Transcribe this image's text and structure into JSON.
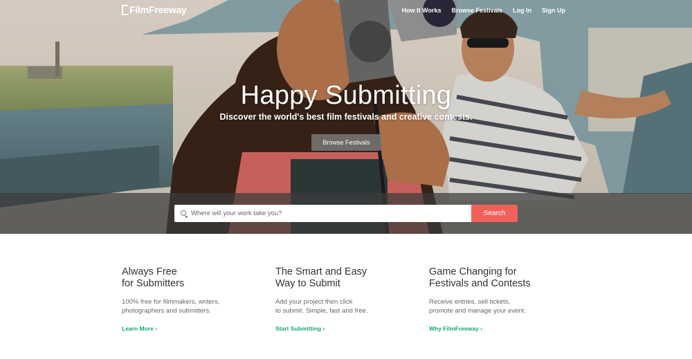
{
  "header": {
    "logo_text": "FilmFreeway",
    "nav": [
      "How It Works",
      "Browse Festivals",
      "Log In",
      "Sign Up"
    ]
  },
  "hero": {
    "title": "Happy Submitting",
    "subtitle": "Discover the world's best film festivals and creative contests.",
    "button_label": "Browse Festivals"
  },
  "search": {
    "placeholder": "Where will your work take you?",
    "button_label": "Search"
  },
  "features": [
    {
      "title_line1": "Always Free",
      "title_line2": "for Submitters",
      "desc_line1": "100% free for filmmakers, writers,",
      "desc_line2": "photographers and submitters.",
      "link": "Learn More ›"
    },
    {
      "title_line1": "The Smart and Easy",
      "title_line2": "Way to Submit",
      "desc_line1": "Add your project then click",
      "desc_line2": "to submit. Simple, fast and free.",
      "link": "Start Submitting ›"
    },
    {
      "title_line1": "Game Changing for",
      "title_line2": "Festivals and Contests",
      "desc_line1": "Receive entries, sell tickets,",
      "desc_line2": "promote and manage your event.",
      "link": "Why FilmFreeway ›"
    }
  ],
  "colors": {
    "accent_search": "#f2605c",
    "link_green": "#1aa37a",
    "search_band": "#3c3c3c"
  }
}
